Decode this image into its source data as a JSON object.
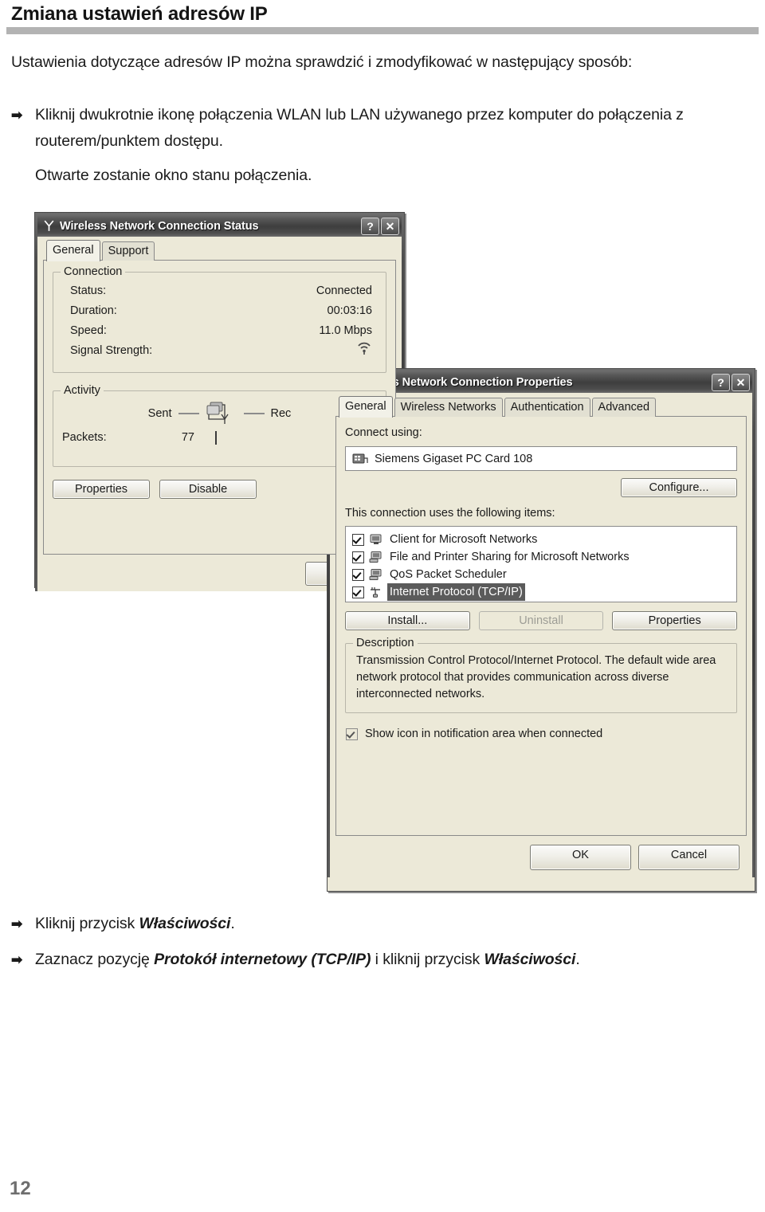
{
  "document": {
    "title": "Zmiana ustawień adresów IP",
    "intro": "Ustawienia dotyczące adresów IP można sprawdzić i zmodyfikować w następujący sposób:",
    "bullet1_text": "Kliknij dwukrotnie ikonę połączenia WLAN lub LAN używanego przez komputer do połączenia z routerem/punktem dostępu.",
    "bullet1_sub": "Otwarte zostanie okno stanu połączenia.",
    "bullet2_pre": "Kliknij przycisk ",
    "bullet2_em": "Właściwości",
    "bullet2_post": ".",
    "bullet3_pre": "Zaznacz pozycję ",
    "bullet3_em": "Protokół internetowy (TCP/IP)",
    "bullet3_mid": " i kliknij przycisk ",
    "bullet3_em2": "Właściwości",
    "bullet3_post": ".",
    "arrow_glyph": "➡",
    "page_number": "12"
  },
  "status_dialog": {
    "title": "Wireless Network Connection Status",
    "title_icon": "wireless-antenna-icon",
    "help_button": "?",
    "close_button": "✕",
    "tabs": [
      {
        "label": "General",
        "active": true
      },
      {
        "label": "Support",
        "active": false
      }
    ],
    "connection_group": {
      "legend": "Connection",
      "rows": [
        {
          "label": "Status:",
          "value": "Connected"
        },
        {
          "label": "Duration:",
          "value": "00:03:16"
        },
        {
          "label": "Speed:",
          "value": "11.0 Mbps"
        },
        {
          "label": "Signal Strength:",
          "value": ""
        }
      ]
    },
    "activity_group": {
      "legend": "Activity",
      "sent_label": "Sent",
      "received_label": "Rec",
      "packets_label": "Packets:",
      "packets_sent": "77",
      "packets_received": ""
    },
    "buttons": {
      "properties": "Properties",
      "disable": "Disable"
    }
  },
  "properties_dialog": {
    "title": "Wireless Network Connection Properties",
    "title_icon": "network-adapter-icon",
    "help_button": "?",
    "close_button": "✕",
    "tabs": [
      {
        "label": "General",
        "active": true
      },
      {
        "label": "Wireless Networks",
        "active": false
      },
      {
        "label": "Authentication",
        "active": false
      },
      {
        "label": "Advanced",
        "active": false
      }
    ],
    "connect_using_label": "Connect using:",
    "adapter_name": "Siemens Gigaset PC Card 108",
    "configure_button": "Configure...",
    "items_label": "This connection uses the following items:",
    "items": [
      {
        "label": "Client for Microsoft Networks",
        "checked": true,
        "selected": false,
        "icon": "monitor-icon"
      },
      {
        "label": "File and Printer Sharing for Microsoft Networks",
        "checked": true,
        "selected": false,
        "icon": "computer-icon"
      },
      {
        "label": "QoS Packet Scheduler",
        "checked": true,
        "selected": false,
        "icon": "computer-icon"
      },
      {
        "label": "Internet Protocol (TCP/IP)",
        "checked": true,
        "selected": true,
        "icon": "protocol-icon"
      }
    ],
    "buttons": {
      "install": "Install...",
      "uninstall": "Uninstall",
      "properties": "Properties"
    },
    "description_group": {
      "legend": "Description",
      "text": "Transmission Control Protocol/Internet Protocol. The default wide area network protocol that provides communication across diverse interconnected networks."
    },
    "show_icon_checkbox": {
      "label": "Show icon in notification area when connected",
      "checked": true
    },
    "footer": {
      "ok": "OK",
      "cancel": "Cancel"
    }
  },
  "colors": {
    "rule": "#b3b3b3",
    "dialog_face": "#ece9d8",
    "selection": "#5b5b5b",
    "page_number": "#6e6e6e"
  }
}
